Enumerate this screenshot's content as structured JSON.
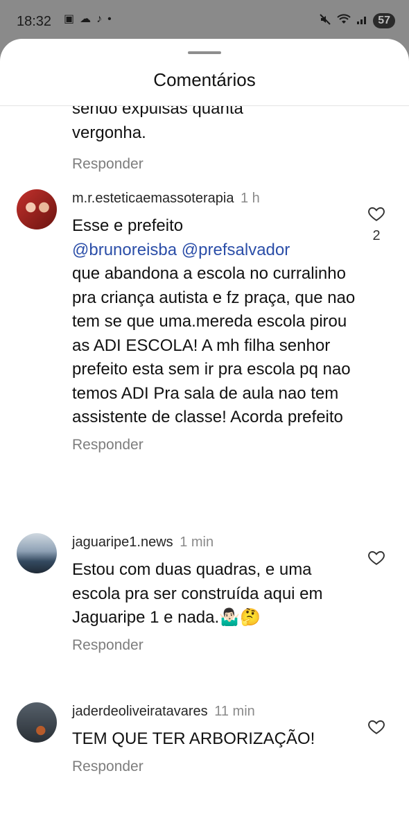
{
  "status_bar": {
    "time": "18:32",
    "left_icons": [
      "screenshot-icon",
      "cloud-icon",
      "tiktok-icon",
      "dot-icon"
    ],
    "right_icons": [
      "mute-icon",
      "wifi-icon",
      "signal-icon"
    ],
    "battery": "57"
  },
  "sheet": {
    "title": "Comentários"
  },
  "partial_comment": {
    "text_lines": [
      "sendo expulsas quanta",
      "vergonha."
    ],
    "reply_label": "Responder"
  },
  "comments": [
    {
      "username": "m.r.esteticaemassoterapia",
      "time": "1 h",
      "text_before": "Esse e prefeito",
      "mentions": [
        "@brunoreisba",
        "@prefsalvador"
      ],
      "text_after": "que abandona a escola no curralinho pra criança autista e fz praça, que nao tem se que uma.mereda escola pirou as ADI ESCOLA! A mh filha senhor prefeito esta sem ir pra escola pq nao temos ADI Pra sala de aula nao tem assistente de classe! Acorda prefeito",
      "likes": "2",
      "reply_label": "Responder"
    },
    {
      "username": "jaguaripe1.news",
      "time": "1 min",
      "text": "Estou com duas quadras, e uma escola pra ser construída aqui em Jaguaripe 1 e nada.🤷🏻‍♂️🤔",
      "likes": "",
      "reply_label": "Responder"
    },
    {
      "username": "jaderdeoliveiratavares",
      "time": "11 min",
      "text": "TEM QUE TER ARBORIZAÇÃO!",
      "likes": "",
      "reply_label": "Responder"
    }
  ],
  "colors": {
    "background_overlay": "#8a8a8a",
    "sheet": "#ffffff",
    "mention": "#2b4ea8",
    "muted": "#8a8a8a"
  }
}
